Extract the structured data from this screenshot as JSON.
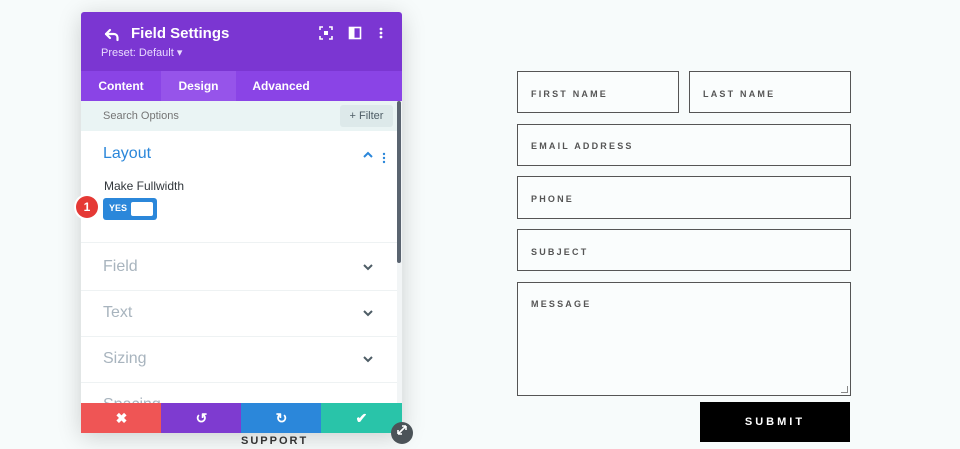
{
  "panel": {
    "title": "Field Settings",
    "preset": "Preset: Default ▾",
    "icons": {
      "back": "undo-arrow-icon",
      "expand": "expand-icon",
      "columns": "columns-icon",
      "more": "kebab-menu-icon"
    },
    "tabs": [
      "Content",
      "Design",
      "Advanced"
    ],
    "active_tab": "Design",
    "search": {
      "placeholder": "Search Options"
    },
    "filter_label": "+ Filter",
    "sections": {
      "layout": {
        "title": "Layout",
        "field_label": "Make Fullwidth",
        "toggle_label": "YES",
        "toggle_on": true,
        "callout": "1"
      },
      "collapsed": [
        "Field",
        "Text",
        "Sizing",
        "Spacing"
      ]
    },
    "footer": {
      "cancel": "✖",
      "undo": "↺",
      "redo": "↻",
      "save": "✔"
    },
    "colors": {
      "header": "#7b36d2",
      "tabs": "#8a44e6",
      "accent": "#2b87da",
      "cancel": "#ef5555",
      "undo": "#7e3bd0",
      "redo": "#2b87da",
      "save": "#29c4a9",
      "callout": "#e53935"
    }
  },
  "support_label": "SUPPORT",
  "form": {
    "first_name": "FIRST NAME",
    "last_name": "LAST NAME",
    "email": "EMAIL ADDRESS",
    "phone": "PHONE",
    "subject": "SUBJECT",
    "message": "MESSAGE",
    "submit": "SUBMIT"
  }
}
